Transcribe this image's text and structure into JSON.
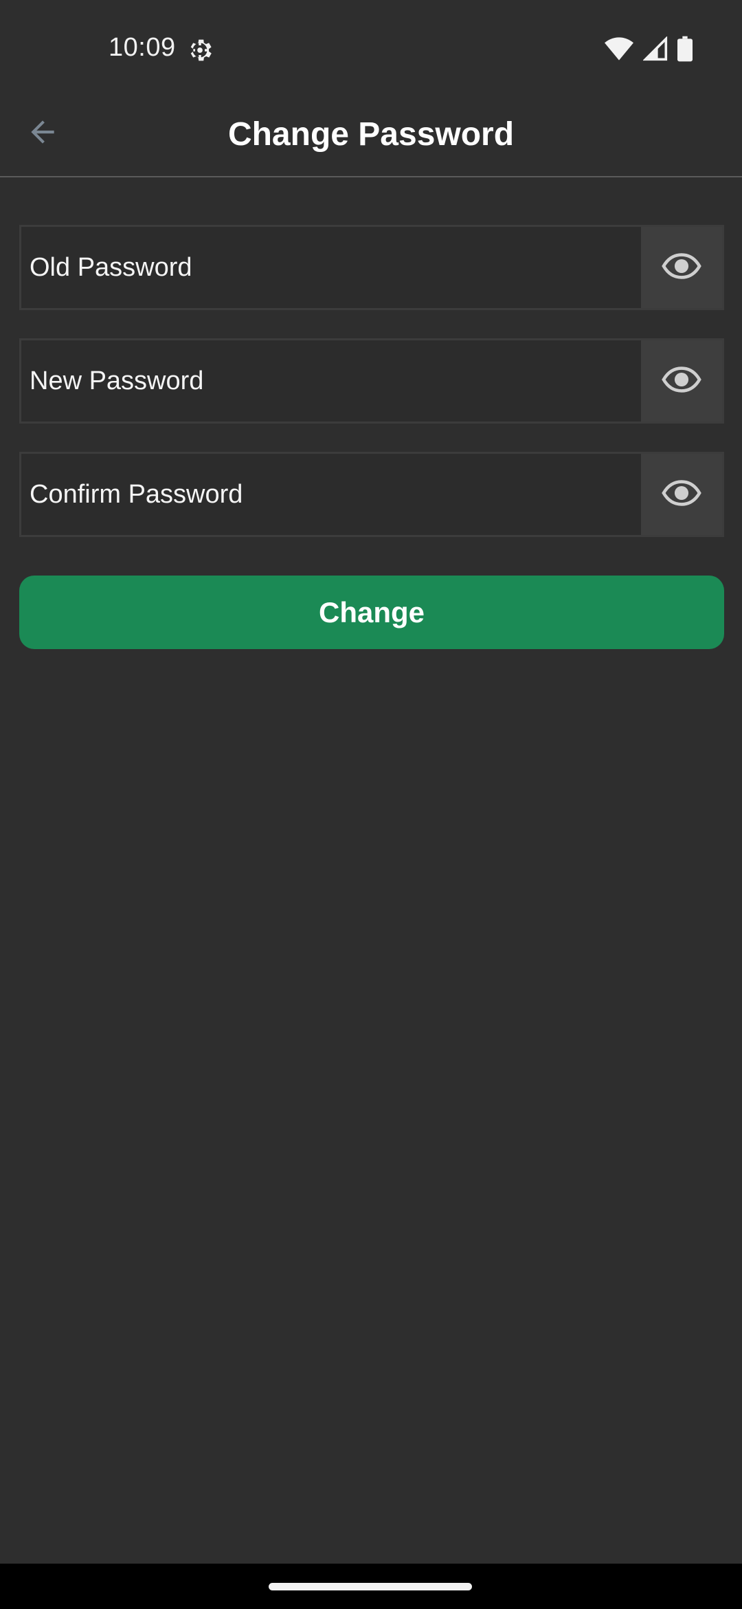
{
  "status_bar": {
    "time": "10:09",
    "icons": [
      "settings-gear-icon",
      "wifi-icon",
      "cellular-signal-icon",
      "battery-icon"
    ]
  },
  "app_bar": {
    "title": "Change Password",
    "back_icon": "arrow-back-icon"
  },
  "form": {
    "old_password": {
      "placeholder": "Old Password",
      "value": "",
      "toggle_icon": "eye-icon"
    },
    "new_password": {
      "placeholder": "New Password",
      "value": "",
      "toggle_icon": "eye-icon"
    },
    "confirm_password": {
      "placeholder": "Confirm Password",
      "value": "",
      "toggle_icon": "eye-icon"
    },
    "submit_label": "Change"
  },
  "colors": {
    "background": "#2e2e2e",
    "accent": "#1b8a55",
    "eye_button_bg": "#3e3e3e",
    "divider": "#5a5a5a"
  }
}
